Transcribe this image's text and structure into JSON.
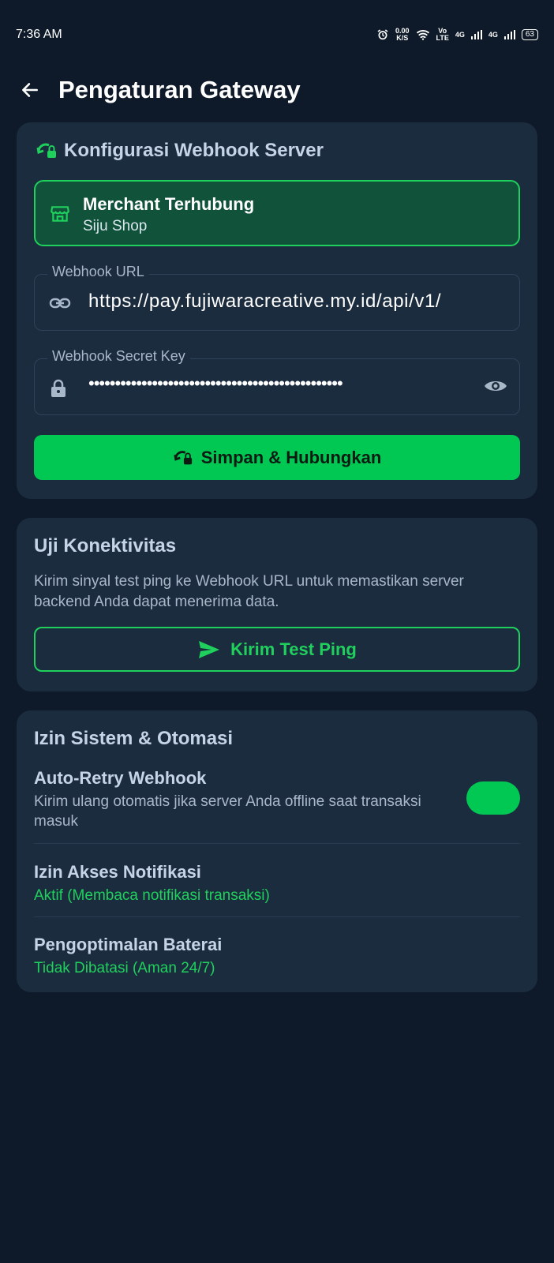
{
  "status_bar": {
    "time": "7:36 AM",
    "net_speed": "0.00\nK/S",
    "volte": "Vo\nLTE",
    "net_4g_1": "4G",
    "net_4g_2": "4G",
    "battery": "63",
    "icons": [
      "alarm-icon",
      "wifi-icon",
      "signal-icon",
      "battery-icon"
    ]
  },
  "header": {
    "title": "Pengaturan Gateway",
    "back_icon": "arrow-left-icon"
  },
  "webhook_card": {
    "title": "Konfigurasi Webhook Server",
    "title_icon": "sync-lock-icon",
    "merchant": {
      "title": "Merchant Terhubung",
      "name": "Siju Shop",
      "icon": "store-icon"
    },
    "url_field": {
      "label": "Webhook URL",
      "value": "https://pay.fujiwaracreative.my.id/api/v1/",
      "icon": "link-icon"
    },
    "key_field": {
      "label": "Webhook Secret Key",
      "value": "••••••••••••••••••••••••••••••••••••••••••••••••",
      "icon": "lock-icon",
      "toggle_icon": "eye-icon"
    },
    "save_button": "Simpan & Hubungkan",
    "save_icon": "sync-lock-icon"
  },
  "connectivity_card": {
    "title": "Uji Konektivitas",
    "description": "Kirim sinyal test ping ke Webhook URL untuk memastikan server backend Anda dapat menerima data.",
    "button": "Kirim Test Ping",
    "button_icon": "send-icon"
  },
  "permissions_card": {
    "title": "Izin Sistem & Otomasi",
    "auto_retry": {
      "title": "Auto-Retry Webhook",
      "description": "Kirim ulang otomatis jika server Anda offline saat transaksi masuk",
      "enabled": true
    },
    "notification": {
      "title": "Izin Akses Notifikasi",
      "status": "Aktif (Membaca notifikasi transaksi)"
    },
    "battery": {
      "title": "Pengoptimalan Baterai",
      "status": "Tidak Dibatasi (Aman 24/7)"
    }
  },
  "colors": {
    "background": "#0e1a29",
    "card": "#1c2c3f",
    "accent": "#00c853",
    "accent_text": "#1fd05c",
    "merchant_bg": "#11523a"
  }
}
